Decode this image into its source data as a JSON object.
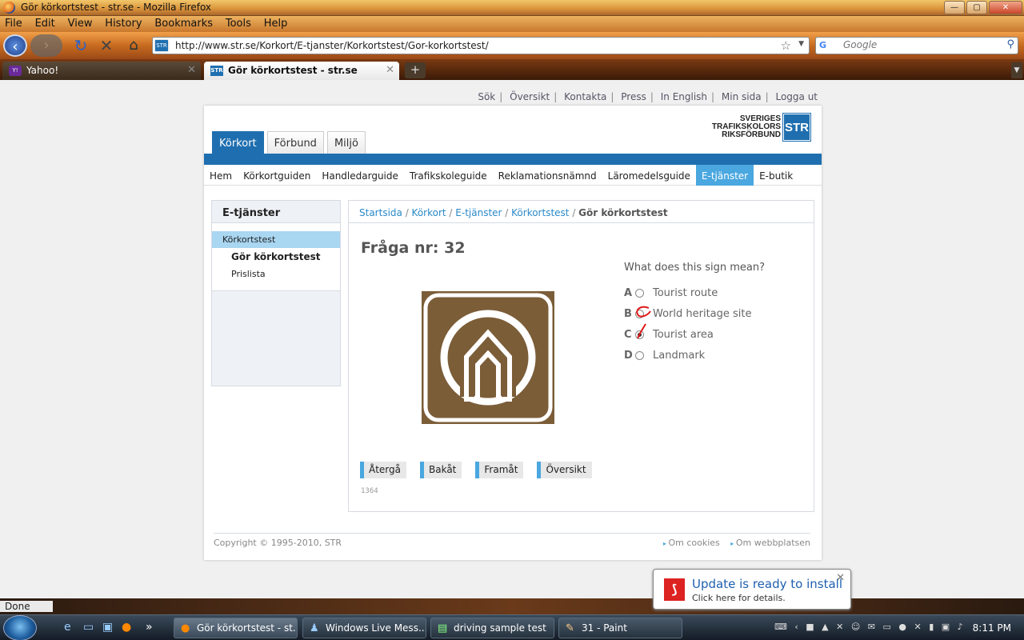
{
  "window": {
    "title": "Gör körkortstest - str.se - Mozilla Firefox",
    "min": "—",
    "max": "▢",
    "close": "✕"
  },
  "menu": [
    "File",
    "Edit",
    "View",
    "History",
    "Bookmarks",
    "Tools",
    "Help"
  ],
  "nav": {
    "url": "http://www.str.se/Korkort/E-tjanster/Korkortstest/Gor-korkortstest/",
    "search_placeholder": "Google",
    "site_icon": "STR"
  },
  "tabs": [
    {
      "label": "Yahoo!",
      "icon": "Y!"
    },
    {
      "label": "Gör körkortstest - str.se",
      "icon": "STR"
    }
  ],
  "site": {
    "toplinks": [
      "Sök",
      "Översikt",
      "Kontakta",
      "Press",
      "In English",
      "Min sida",
      "Logga ut"
    ],
    "logo": {
      "line1": "SVERIGES",
      "line2": "TRAFIKSKOLORS",
      "line3": "RIKSFÖRBUND",
      "mark": "STR"
    },
    "main_tabs": [
      "Körkort",
      "Förbund",
      "Miljö"
    ],
    "subnav": [
      "Hem",
      "Körkortguiden",
      "Handledarguide",
      "Trafikskoleguide",
      "Reklamationsnämnd",
      "Läromedelsguide",
      "E-tjänster",
      "E-butik"
    ],
    "sidebar": {
      "title": "E-tjänster",
      "items": [
        "Körkortstest",
        "Gör körkortstest",
        "Prislista"
      ]
    },
    "breadcrumb": {
      "items": [
        "Startsida",
        "Körkort",
        "E-tjänster",
        "Körkortstest"
      ],
      "current": "Gör körkortstest",
      "sep": " / "
    },
    "question_title": "Fråga nr: 32",
    "question": "What does this sign mean?",
    "answers": [
      {
        "letter": "A",
        "text": "Tourist route"
      },
      {
        "letter": "B",
        "text": "World heritage site"
      },
      {
        "letter": "C",
        "text": "Tourist area"
      },
      {
        "letter": "D",
        "text": "Landmark"
      }
    ],
    "buttons": [
      "Återgå",
      "Bakåt",
      "Framåt",
      "Översikt"
    ],
    "code": "1364",
    "footer": {
      "copyright": "Copyright © 1995-2010, STR",
      "links": [
        "Om cookies",
        "Om webbplatsen"
      ]
    }
  },
  "status": {
    "text": "Done"
  },
  "toast": {
    "title": "Update is ready to install",
    "body": "Click here for details.",
    "icon": "pdf-icon"
  },
  "taskbar": {
    "tasks": [
      "Gör körkortstest - st...",
      "Windows Live Mess...",
      "driving sample test",
      "31 - Paint"
    ],
    "clock": "8:11 PM"
  },
  "colors": {
    "accent": "#1f6fb0",
    "light_accent": "#4aa7df",
    "sign_brown": "#7b5d38"
  }
}
